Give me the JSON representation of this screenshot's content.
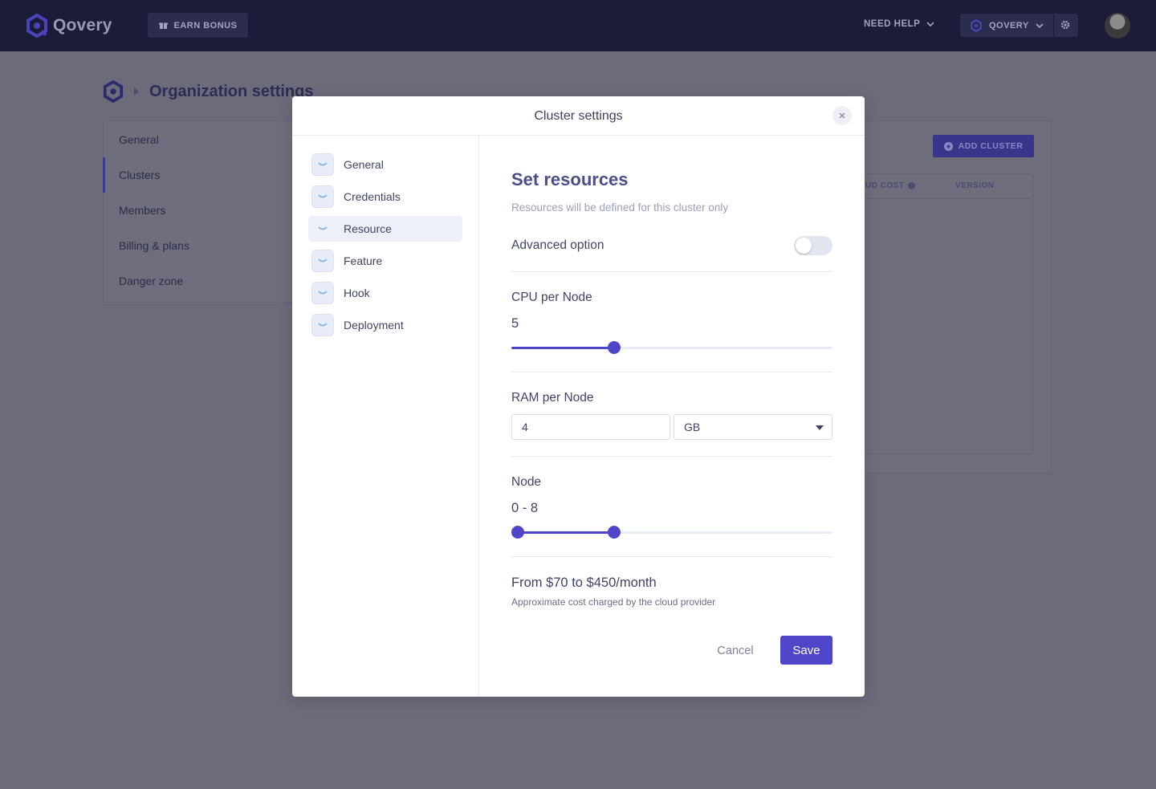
{
  "topbar": {
    "brand": "Qovery",
    "earn_bonus": "EARN BONUS",
    "need_help": "NEED HELP",
    "org": "QOVERY"
  },
  "background": {
    "breadcrumb_title": "Organization settings",
    "nav": [
      "General",
      "Clusters",
      "Members",
      "Billing & plans",
      "Danger zone"
    ],
    "active_nav": "Clusters",
    "add_cluster": "ADD CLUSTER",
    "table_headers": [
      "UD COST",
      "VERSION"
    ]
  },
  "modal": {
    "title": "Cluster settings",
    "steps": [
      "General",
      "Credentials",
      "Resource",
      "Feature",
      "Hook",
      "Deployment"
    ],
    "active_step": "Resource",
    "heading": "Set resources",
    "subtitle": "Resources will be defined for this cluster only",
    "advanced_label": "Advanced option",
    "advanced_on": false,
    "cpu_label": "CPU per Node",
    "cpu_value": "5",
    "cpu_fraction": 0.32,
    "ram_label": "RAM per Node",
    "ram_value": "4",
    "ram_unit": "GB",
    "node_label": "Node",
    "node_value": "0 - 8",
    "node_range_fraction": [
      0.02,
      0.32
    ],
    "cost": "From $70 to $450/month",
    "cost_sub": "Approximate cost charged by the cloud provider",
    "cancel": "Cancel",
    "save": "Save"
  },
  "colors": {
    "accent": "#5044c8",
    "topbar": "#1c1c3a",
    "overlay": "#6b6b7a"
  }
}
